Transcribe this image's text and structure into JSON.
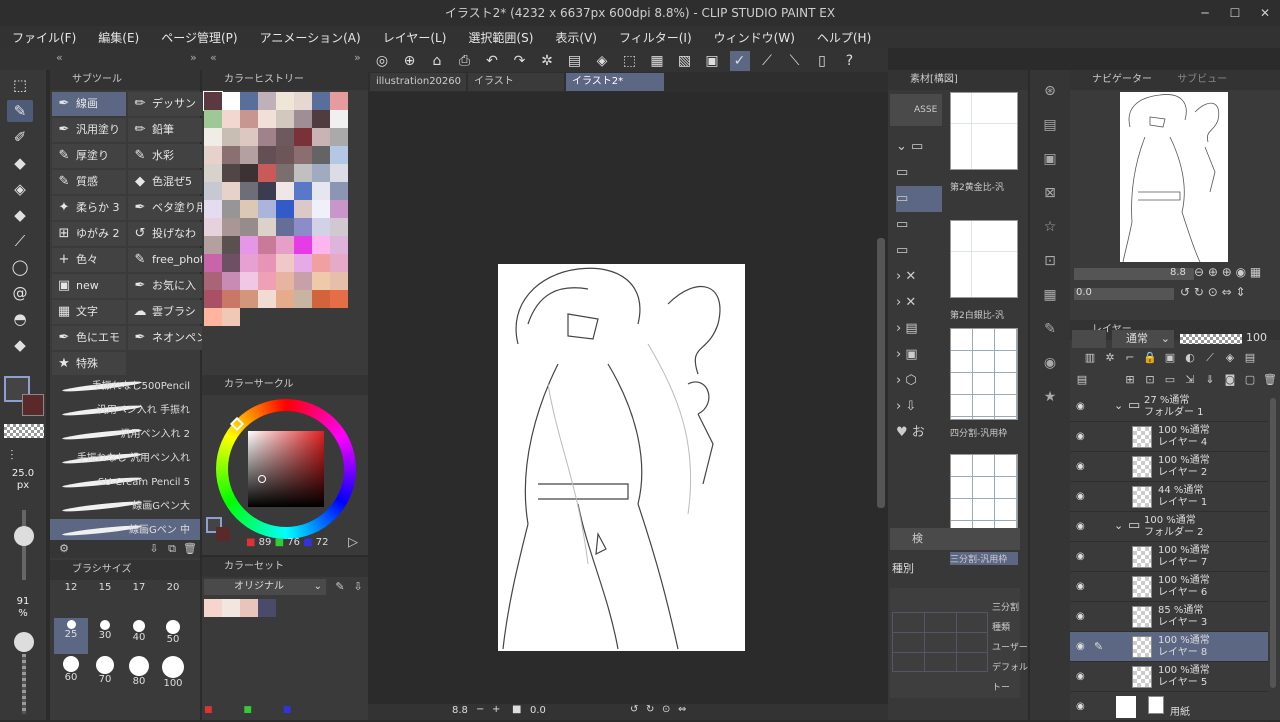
{
  "window": {
    "title": "イラスト2* (4232 x 6637px 600dpi 8.8%)  - CLIP STUDIO PAINT EX",
    "min": "─",
    "max": "☐",
    "close": "✕"
  },
  "menu": [
    "ファイル(F)",
    "編集(E)",
    "ページ管理(P)",
    "アニメーション(A)",
    "レイヤー(L)",
    "選択範囲(S)",
    "表示(V)",
    "フィルター(I)",
    "ウィンドウ(W)",
    "ヘルプ(H)"
  ],
  "subtool": {
    "header": "サブツール",
    "items": [
      {
        "label": "線画",
        "icon": "pen-icon",
        "sel": true
      },
      {
        "label": "デッサン",
        "icon": "pencil-icon",
        "sel": false
      },
      {
        "label": "汎用塗り",
        "icon": "pen-icon",
        "sel": false
      },
      {
        "label": "鉛筆",
        "icon": "pencil-icon",
        "sel": false
      },
      {
        "label": "厚塗り",
        "icon": "brush-icon",
        "sel": false
      },
      {
        "label": "水彩",
        "icon": "brush-icon",
        "sel": false
      },
      {
        "label": "質感",
        "icon": "brush-icon",
        "sel": false
      },
      {
        "label": "色混ぜ5",
        "icon": "drop-icon",
        "sel": false
      },
      {
        "label": "柔らか 3",
        "icon": "airbrush-icon",
        "sel": false
      },
      {
        "label": "ベタ塗り用",
        "icon": "pen-icon",
        "sel": false
      },
      {
        "label": "ゆがみ 2",
        "icon": "warp-icon",
        "sel": false
      },
      {
        "label": "投げなわ",
        "icon": "lasso-icon",
        "sel": false
      },
      {
        "label": "色々",
        "icon": "plus-icon",
        "sel": false
      },
      {
        "label": "free_phot",
        "icon": "brush-icon",
        "sel": false
      },
      {
        "label": "new",
        "icon": "new-icon",
        "sel": false
      },
      {
        "label": "お気に入",
        "icon": "pen-icon",
        "sel": false
      },
      {
        "label": "文字",
        "icon": "text-icon",
        "sel": false
      },
      {
        "label": "雲ブラシ",
        "icon": "cloud-icon",
        "sel": false
      },
      {
        "label": "色にエモ",
        "icon": "pen-icon",
        "sel": false
      },
      {
        "label": "ネオンペン",
        "icon": "pen-icon",
        "sel": false
      },
      {
        "label": "特殊",
        "icon": "special-icon",
        "sel": false
      }
    ]
  },
  "brushes": [
    {
      "label": "手振れなし500Pencil",
      "sel": false
    },
    {
      "label": "汎用ペン入れ 手振れ",
      "sel": false
    },
    {
      "label": "汎用ペン入れ 2",
      "sel": false
    },
    {
      "label": "手振れなし 汎用ペン入れ",
      "sel": false
    },
    {
      "label": "SU-Cream Pencil 5",
      "sel": false
    },
    {
      "label": "線画Gペン大",
      "sel": false
    },
    {
      "label": "線画Gペン 中",
      "sel": true
    }
  ],
  "brushsize": {
    "header": "ブラシサイズ",
    "current": "25.0",
    "unit": "px",
    "opacity": "91",
    "opacity_unit": "%",
    "sizes": [
      {
        "v": "12",
        "sel": false
      },
      {
        "v": "15",
        "sel": false
      },
      {
        "v": "17",
        "sel": false
      },
      {
        "v": "20",
        "sel": false
      },
      {
        "v": "25",
        "sel": true
      },
      {
        "v": "30",
        "sel": false
      },
      {
        "v": "40",
        "sel": false
      },
      {
        "v": "50",
        "sel": false
      },
      {
        "v": "60",
        "sel": false
      },
      {
        "v": "70",
        "sel": false
      },
      {
        "v": "80",
        "sel": false
      },
      {
        "v": "100",
        "sel": false
      }
    ]
  },
  "history": {
    "header": "カラーヒストリー",
    "swatches": [
      "#5a3a40",
      "#ffffff",
      "#5a6e9c",
      "#c0b0b8",
      "#efe6d8",
      "#e6d8d0",
      "#5a6e9c",
      "#e69c9c",
      "#a0c896",
      "#f0d8d0",
      "#c89690",
      "#f0e0d8",
      "#d2c8be",
      "#a08e96",
      "#503c40",
      "#f0f0f0",
      "#f0ece6",
      "#c8beb4",
      "#dcc8c0",
      "#a0828a",
      "#6e5a5e",
      "#7a3238",
      "#c8b4b4",
      "#aaaaaa",
      "#e6d2ca",
      "#8a7070",
      "#b4a0a0",
      "#645054",
      "#6e5658",
      "#8a6e70",
      "#646464",
      "#b4c8e6",
      "#d7d2cc",
      "#504646",
      "#3c3234",
      "#c85a5a",
      "#7a6e6e",
      "#c0c0c0",
      "#a0aac0",
      "#dcdce6",
      "#c8c8d2",
      "#e6d2c8",
      "#6e6e78",
      "#3c3c50",
      "#f0e6e6",
      "#5a78c8",
      "#e6e6f0",
      "#8c96b4",
      "#e6dcf0",
      "#969696",
      "#dcc8b4",
      "#aab4dc",
      "#325ac8",
      "#dcc8c8",
      "#f0f0fa",
      "#c896c8",
      "#e6d2dc",
      "#aa9696",
      "#968c8c",
      "#dcd2c8",
      "#646e96",
      "#8c8cc8",
      "#d2d2e6",
      "#d2c8d2",
      "#b4a0a0",
      "#5a5050",
      "#e696e6",
      "#c87a96",
      "#e6a0c8",
      "#e63ce6",
      "#ffb4f0",
      "#dcb4dc",
      "#c864aa",
      "#6e5064",
      "#e6a0d2",
      "#e696b4",
      "#f0c8c8",
      "#e6aae6",
      "#f0a0a0",
      "#e6aac8",
      "#aa6478",
      "#c88cb4",
      "#f0c8e6",
      "#f0a0b4",
      "#e6b4a0",
      "#c8a0aa",
      "#f0c8aa",
      "#e6beaa",
      "#aa5064",
      "#c87864",
      "#d2967a",
      "#f0dcd2",
      "#e6aa8c",
      "#c8b4a0",
      "#d2643c",
      "#e66e46",
      "#ffb4a0",
      "#f0c8b4"
    ]
  },
  "colorcircle": {
    "header": "カラーサークル",
    "r": "89",
    "g": "76",
    "b": "72"
  },
  "colorset": {
    "header": "カラーセット",
    "selected": "オリジナル",
    "swatches": [
      "#f5d5cc",
      "#f2e6e0",
      "#e8c4bc",
      "#4a4a6a"
    ]
  },
  "tabs": [
    {
      "label": "illustration20260",
      "act": false
    },
    {
      "label": "イラスト",
      "act": false
    },
    {
      "label": "イラスト2*",
      "act": true
    }
  ],
  "canvas": {
    "zoom": "8.8",
    "rotate": "0.0"
  },
  "material": {
    "header": "素材[構図]",
    "asset": "ASSE",
    "search": "検",
    "kind": "種別",
    "items": [
      "第2黄金比-汎",
      "第2白銀比-汎",
      "四分割-汎用枠",
      "三分割-汎用枠"
    ],
    "detail": [
      "三分割",
      "種類",
      "ユーザー",
      "デフォル",
      "トー"
    ],
    "folder_note": "お"
  },
  "navigator": {
    "header": "ナビゲーター",
    "header2": "サブビュー",
    "zoom": "8.8",
    "rotate": "0.0"
  },
  "layers": {
    "header": "レイヤー",
    "blend": "通常",
    "opacity": "100",
    "rows": [
      {
        "l1": "27 %通常",
        "l2": "フォルダー 1",
        "folder": true,
        "sel": false,
        "pen": false
      },
      {
        "l1": "100 %通常",
        "l2": "レイヤー 4",
        "folder": false,
        "sel": false,
        "pen": false
      },
      {
        "l1": "100 %通常",
        "l2": "レイヤー 2",
        "folder": false,
        "sel": false,
        "pen": false
      },
      {
        "l1": "44 %通常",
        "l2": "レイヤー 1",
        "folder": false,
        "sel": false,
        "pen": false
      },
      {
        "l1": "100 %通常",
        "l2": "フォルダー 2",
        "folder": true,
        "sel": false,
        "pen": false
      },
      {
        "l1": "100 %通常",
        "l2": "レイヤー 7",
        "folder": false,
        "sel": false,
        "pen": false
      },
      {
        "l1": "100 %通常",
        "l2": "レイヤー 6",
        "folder": false,
        "sel": false,
        "pen": false
      },
      {
        "l1": "85 %通常",
        "l2": "レイヤー 3",
        "folder": false,
        "sel": false,
        "pen": false
      },
      {
        "l1": "100 %通常",
        "l2": "レイヤー 8",
        "folder": false,
        "sel": true,
        "pen": true
      },
      {
        "l1": "100 %通常",
        "l2": "レイヤー 5",
        "folder": false,
        "sel": false,
        "pen": false
      },
      {
        "l1": "",
        "l2": "用紙",
        "folder": false,
        "sel": false,
        "pen": false
      }
    ]
  }
}
